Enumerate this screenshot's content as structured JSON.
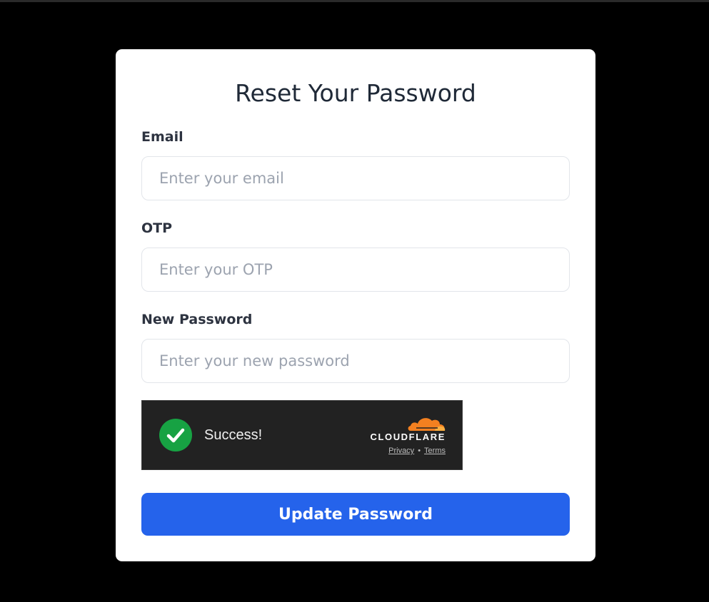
{
  "form": {
    "title": "Reset Your Password",
    "email": {
      "label": "Email",
      "placeholder": "Enter your email",
      "value": ""
    },
    "otp": {
      "label": "OTP",
      "placeholder": "Enter your OTP",
      "value": ""
    },
    "new_password": {
      "label": "New Password",
      "placeholder": "Enter your new password",
      "value": ""
    },
    "submit_label": "Update Password"
  },
  "captcha": {
    "status_text": "Success!",
    "brand": "CLOUDFLARE",
    "privacy_label": "Privacy",
    "separator": "•",
    "terms_label": "Terms",
    "status_icon": "check-circle-icon",
    "logo_icon": "cloudflare-cloud-icon"
  },
  "colors": {
    "page_background": "#000000",
    "card_background": "#ffffff",
    "primary_button": "#2563eb",
    "success_green": "#17a243",
    "cloudflare_orange": "#f38020",
    "captcha_background": "#222222"
  }
}
